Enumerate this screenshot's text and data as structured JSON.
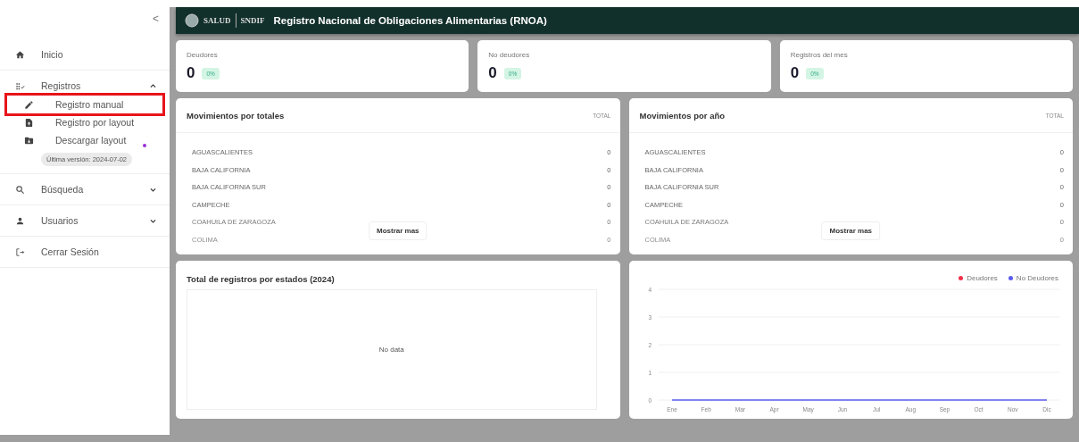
{
  "sidebar": {
    "collapse_icon_char": "<",
    "items": [
      {
        "kind": "link",
        "label": "Inicio"
      },
      {
        "kind": "group",
        "label": "Registros",
        "expanded": true,
        "children": [
          {
            "label": "Registro manual",
            "highlighted": true
          },
          {
            "label": "Registro por layout",
            "highlighted": false
          },
          {
            "label": "Descargar layout",
            "highlighted": false,
            "badge": "Última versión: 2024-07-02"
          }
        ]
      },
      {
        "kind": "group",
        "label": "Búsqueda",
        "expanded": false
      },
      {
        "kind": "group",
        "label": "Usuarios",
        "expanded": false
      },
      {
        "kind": "link",
        "label": "Cerrar Sesión"
      }
    ]
  },
  "header": {
    "logo_left": "SALUD",
    "logo_right": "SNDIF",
    "title": "Registro Nacional de Obligaciones Alimentarias (RNOA)"
  },
  "stats": [
    {
      "label": "Deudores",
      "value": "0",
      "percent": "0%"
    },
    {
      "label": "No deudores",
      "value": "0",
      "percent": "0%"
    },
    {
      "label": "Registros del mes",
      "value": "0",
      "percent": "0%"
    }
  ],
  "tables": [
    {
      "title": "Movimientos por totales",
      "column": "TOTAL",
      "button": "Mostrar mas",
      "rows": [
        {
          "name": "AGUASCALIENTES",
          "value": "0"
        },
        {
          "name": "BAJA CALIFORNIA",
          "value": "0"
        },
        {
          "name": "BAJA CALIFORNIA SUR",
          "value": "0"
        },
        {
          "name": "CAMPECHE",
          "value": "0"
        },
        {
          "name": "COAHUILA DE ZARAGOZA",
          "value": "0"
        },
        {
          "name": "COLIMA",
          "value": "0"
        }
      ]
    },
    {
      "title": "Movimientos por año",
      "column": "TOTAL",
      "button": "Mostrar mas",
      "rows": [
        {
          "name": "AGUASCALIENTES",
          "value": "0"
        },
        {
          "name": "BAJA CALIFORNIA",
          "value": "0"
        },
        {
          "name": "BAJA CALIFORNIA SUR",
          "value": "0"
        },
        {
          "name": "CAMPECHE",
          "value": "0"
        },
        {
          "name": "COAHUILA DE ZARAGOZA",
          "value": "0"
        },
        {
          "name": "COLIMA",
          "value": "0"
        }
      ]
    }
  ],
  "states_panel": {
    "title": "Total de registros por estados (2024)",
    "empty_text": "No data"
  },
  "line_panel": {
    "chart_data": {
      "type": "line",
      "categories": [
        "Ene",
        "Feb",
        "Mar",
        "Apr",
        "May",
        "Jun",
        "Jul",
        "Aug",
        "Sep",
        "Oct",
        "Nov",
        "Dic"
      ],
      "ylim": [
        0,
        4
      ],
      "yticks": [
        0,
        1,
        2,
        3,
        4
      ],
      "grid": true,
      "series": [
        {
          "name": "Deudores",
          "color": "#f0304a",
          "values": [
            null,
            null,
            null,
            null,
            null,
            null,
            null,
            null,
            null,
            null,
            null,
            null
          ]
        },
        {
          "name": "No Deudores",
          "color": "#5b5bf0",
          "values": [
            0,
            0,
            0,
            0,
            0,
            0,
            0,
            0,
            0,
            0,
            0,
            0
          ]
        }
      ]
    }
  }
}
